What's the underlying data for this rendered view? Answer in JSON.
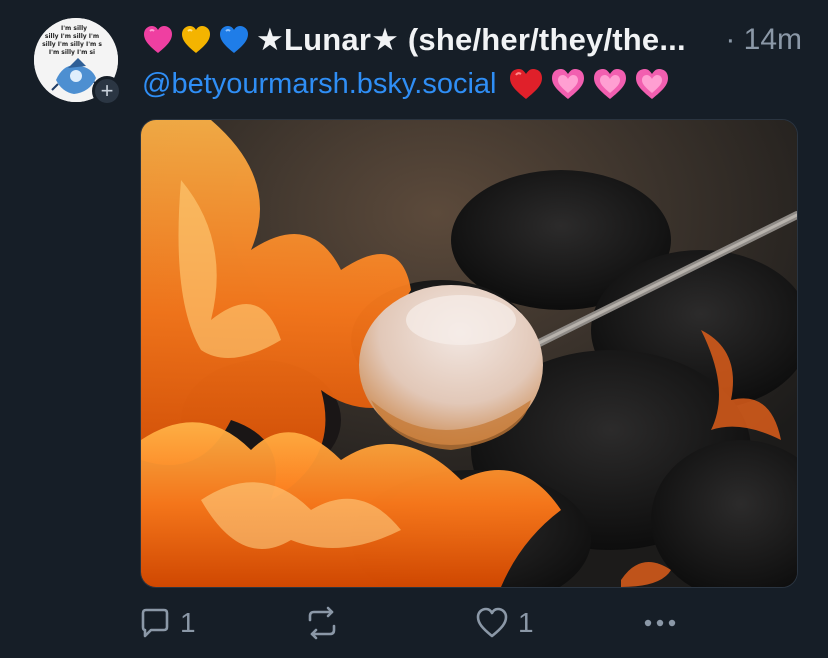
{
  "post": {
    "display_name": "★Lunar★ (she/her/they/the...",
    "name_emoji": [
      "pink-heart-icon",
      "yellow-heart-icon",
      "blue-heart-icon"
    ],
    "timestamp": "· 14m",
    "handle": "@betyourmarsh.bsky.social",
    "handle_emoji": [
      "red-heart-icon",
      "sparkling-heart-icon",
      "sparkling-heart-icon",
      "sparkling-heart-icon"
    ],
    "avatar_text": [
      "I'm silly",
      "silly I'm silly I'm",
      "silly I'm silly I'm s",
      "I'm silly I'm si"
    ],
    "follow_symbol": "+",
    "image_description_hidden": "",
    "actions": {
      "reply_count": "1",
      "like_count": "1"
    }
  },
  "colors": {
    "background": "#161e27",
    "handle": "#2f8ef5",
    "muted": "#8b98a7",
    "text": "#f1f3f5"
  }
}
